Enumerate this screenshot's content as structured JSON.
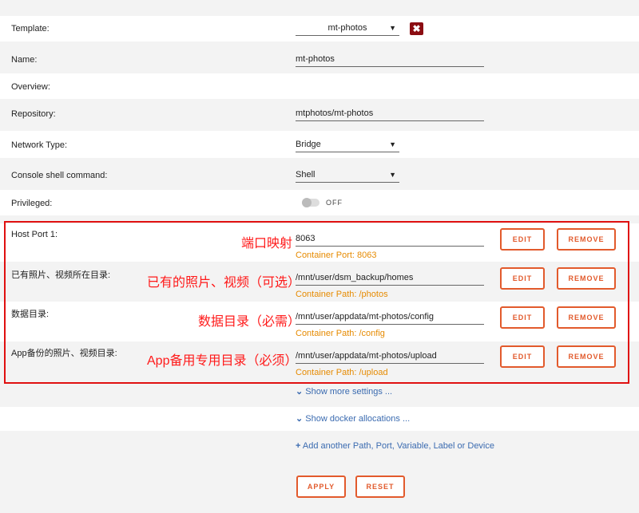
{
  "form": {
    "template": {
      "label": "Template:",
      "value": "mt-photos",
      "arrow": "▼",
      "clear": "✖"
    },
    "name": {
      "label": "Name:",
      "value": "mt-photos"
    },
    "overview": {
      "label": "Overview:"
    },
    "repository": {
      "label": "Repository:",
      "value": "mtphotos/mt-photos"
    },
    "network_type": {
      "label": "Network Type:",
      "value": "Bridge",
      "arrow": "▼"
    },
    "console_shell": {
      "label": "Console shell command:",
      "value": "Shell",
      "arrow": "▼"
    },
    "privileged": {
      "label": "Privileged:",
      "state": "OFF"
    }
  },
  "mappings": [
    {
      "label": "Host Port 1:",
      "value": "8063",
      "hint": "Container Port: 8063",
      "annotation": "端口映射",
      "edit": "EDIT",
      "remove": "REMOVE"
    },
    {
      "label": "已有照片、视频所在目录:",
      "value": "/mnt/user/dsm_backup/homes",
      "hint": "Container Path: /photos",
      "annotation": "已有的照片、视频（可选）",
      "edit": "EDIT",
      "remove": "REMOVE"
    },
    {
      "label": "数据目录:",
      "value": "/mnt/user/appdata/mt-photos/config",
      "hint": "Container Path: /config",
      "annotation": "数据目录（必需）",
      "edit": "EDIT",
      "remove": "REMOVE"
    },
    {
      "label": "App备份的照片、视频目录:",
      "value": "/mnt/user/appdata/mt-photos/upload",
      "hint": "Container Path: /upload",
      "annotation": "App备用专用目录（必须）",
      "edit": "EDIT",
      "remove": "REMOVE"
    }
  ],
  "links": {
    "more_settings": "Show more settings ...",
    "docker_allocations": "Show docker allocations ...",
    "add_another": "Add another Path, Port, Variable, Label or Device"
  },
  "actions": {
    "apply": "APPLY",
    "reset": "RESET"
  },
  "colors": {
    "accent": "#e25a2c",
    "hint": "#e68a00",
    "annotation": "#ff1a1a",
    "link": "#3b6bb0"
  }
}
